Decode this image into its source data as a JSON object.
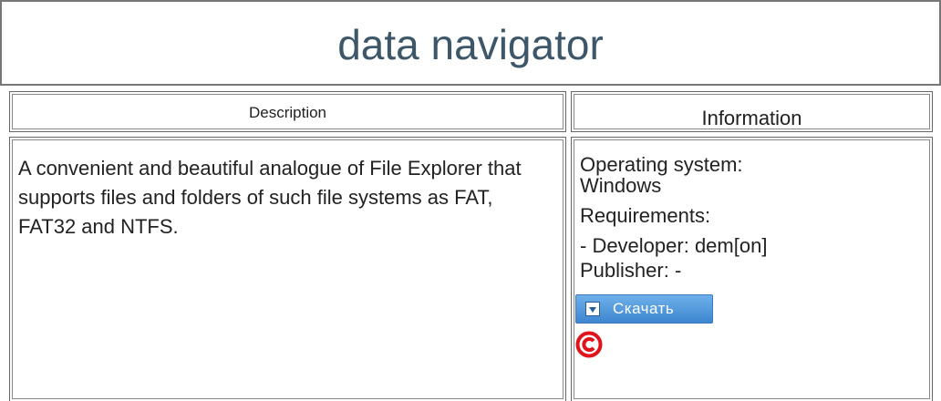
{
  "title": "data navigator",
  "headers": {
    "description": "Description",
    "information": "Information"
  },
  "description": "A convenient and beautiful analogue of File Explorer that supports files and folders of such file systems as FAT, FAT32 and NTFS.",
  "info": {
    "os_label": "Operating system:",
    "os_value": "Windows",
    "requirements_label": "Requirements:",
    "developer": "- Developer: dem[on]",
    "publisher": "Publisher: -"
  },
  "download_button": {
    "label": "Скачать",
    "icon": "download-icon",
    "color": "#4a90d9"
  },
  "copyright_icon": "copyright-icon",
  "colors": {
    "title": "#3e5768",
    "copyright": "#e0141b"
  }
}
